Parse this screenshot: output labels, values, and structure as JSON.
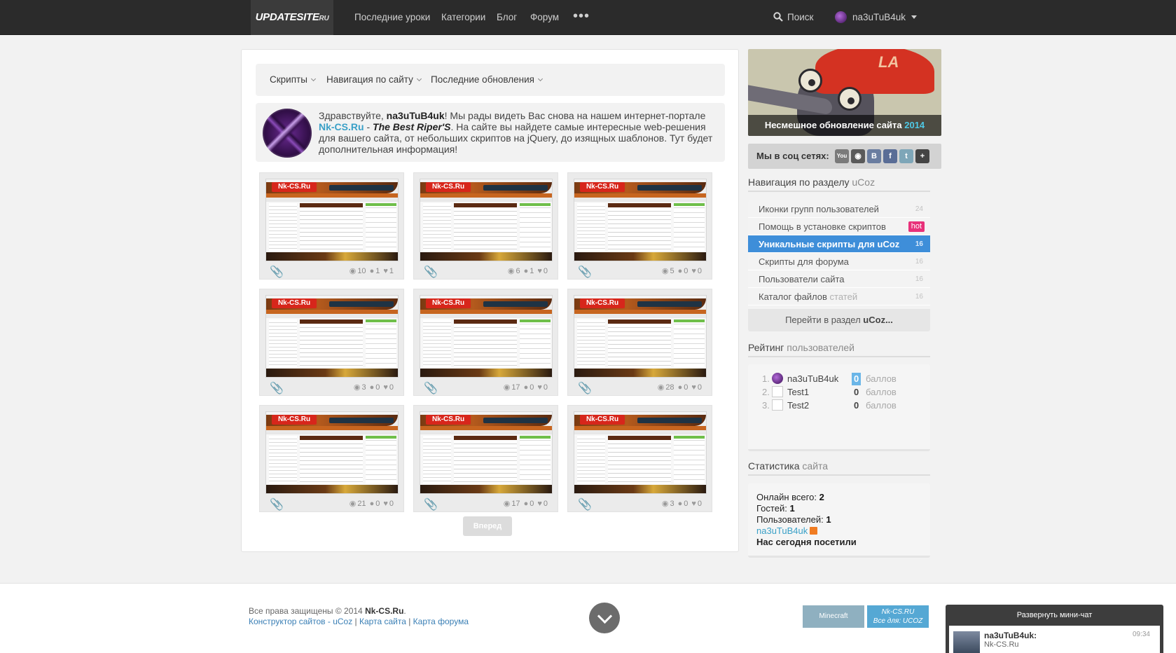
{
  "header": {
    "logo_main": "UPDATESITE",
    "logo_suffix": "RU",
    "nav": [
      "Последние уроки",
      "Категории",
      "Блог",
      "Форум"
    ],
    "more": "•••",
    "search_label": "Поиск",
    "user_name": "na3uTuB4uk"
  },
  "subnav": {
    "items": [
      "Скрипты",
      "Навигация по сайту",
      "Последние обновления"
    ]
  },
  "welcome": {
    "greeting": "Здравствуйте, ",
    "user": "na3uTuB4uk",
    "part1": "! Мы рады видеть Вас снова на нашем интернет-портале ",
    "site": "Nk-CS.Ru",
    "dash": " - ",
    "slogan": "The Best Riper'S",
    "part2": ". На сайте вы найдете самые интересные web-решения для вашего сайта, от небольших скриптов на jQuery, до изящных шаблонов. Тут будет дополнительная информация!"
  },
  "cards": [
    {
      "brand": "Nk-CS.Ru",
      "views": "10",
      "comments": "1",
      "likes": "1"
    },
    {
      "brand": "Nk-CS.Ru",
      "views": "6",
      "comments": "1",
      "likes": "0"
    },
    {
      "brand": "Nk-CS.Ru",
      "views": "5",
      "comments": "0",
      "likes": "0"
    },
    {
      "brand": "Nk-CS.Ru",
      "views": "3",
      "comments": "0",
      "likes": "0"
    },
    {
      "brand": "Nk-CS.Ru",
      "views": "17",
      "comments": "0",
      "likes": "0"
    },
    {
      "brand": "Nk-CS.Ru",
      "views": "28",
      "comments": "0",
      "likes": "0"
    },
    {
      "brand": "Nk-CS.Ru",
      "views": "21",
      "comments": "0",
      "likes": "0"
    },
    {
      "brand": "Nk-CS.Ru",
      "views": "17",
      "comments": "0",
      "likes": "0"
    },
    {
      "brand": "Nk-CS.Ru",
      "views": "3",
      "comments": "0",
      "likes": "0"
    }
  ],
  "pager": {
    "next_label": "Вперед"
  },
  "promo": {
    "caption": "Несмешное обновление сайта ",
    "year": "2014",
    "cap_text": "LA"
  },
  "social": {
    "label": "Мы в соц сетях:",
    "icons": [
      {
        "name": "youtube-icon",
        "glyph": "You",
        "color": "#7a7a7a"
      },
      {
        "name": "instagram-icon",
        "glyph": "◉",
        "color": "#5a5a5a"
      },
      {
        "name": "vk-icon",
        "glyph": "В",
        "color": "#6a7da0"
      },
      {
        "name": "facebook-icon",
        "glyph": "f",
        "color": "#5a6d96"
      },
      {
        "name": "twitter-icon",
        "glyph": "t",
        "color": "#7ea6b8"
      },
      {
        "name": "plus-icon",
        "glyph": "+",
        "color": "#444"
      }
    ]
  },
  "nav_section": {
    "title": "Навигация по разделу ",
    "accent": "uCoz",
    "items": [
      {
        "label": "Иконки групп пользователей",
        "count": "24"
      },
      {
        "label": "Помощь в установке скриптов",
        "badge": "hot"
      },
      {
        "label": "Уникальные скрипты для uCoz",
        "count": "16"
      },
      {
        "label": "Скрипты для форума",
        "count": "16"
      },
      {
        "label": "Пользователи сайта",
        "count": "16"
      },
      {
        "label": "Каталог файлов ",
        "muted": "статей",
        "count": "16"
      }
    ],
    "footer_prefix": "Перейти в раздел ",
    "footer_bold": "uCoz..."
  },
  "rating": {
    "title": "Рейтинг ",
    "accent": "пользователей",
    "rows": [
      {
        "num": "1.",
        "name": "na3uTuB4uk",
        "points": "0",
        "word": "баллов"
      },
      {
        "num": "2.",
        "name": "Test1",
        "points": "0",
        "word": "баллов"
      },
      {
        "num": "3.",
        "name": "Test2",
        "points": "0",
        "word": "баллов"
      }
    ]
  },
  "stats": {
    "title": "Статистика ",
    "accent": "сайта",
    "online_label": "Онлайн всего: ",
    "online": "2",
    "guests_label": "Гостей: ",
    "guests": "1",
    "users_label": "Пользователей: ",
    "users": "1",
    "user_link": "na3uTuB4uk",
    "visited": "Нас сегодня посетили"
  },
  "footer": {
    "copy_prefix": "Все права защищены © 2014 ",
    "copy_site": "Nk-CS.Ru",
    "copy_dot": ".",
    "link1": "Конструктор сайтов - uCoz",
    "sep": " | ",
    "link2": "Карта сайта",
    "link3": "Карта форума",
    "banner1": "Minecraft",
    "banner2_line1": "Nk-CS.RU",
    "banner2_line2": "Все для: UCOZ"
  },
  "chat": {
    "header": "Развернуть мини-чат",
    "name": "na3uTuB4uk:",
    "text": "Nk-CS.Ru",
    "time": "09:34"
  }
}
